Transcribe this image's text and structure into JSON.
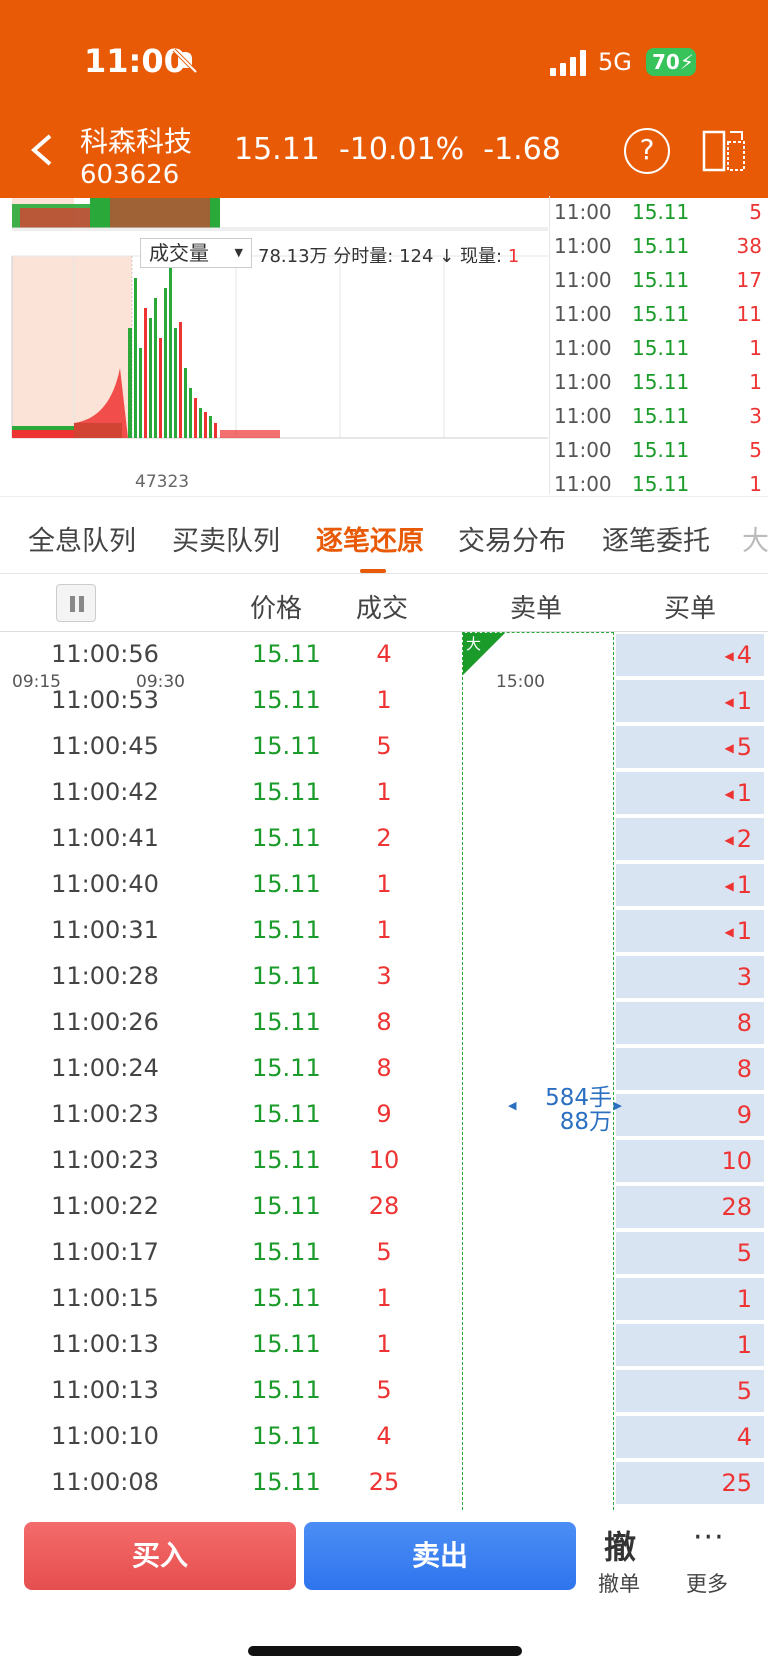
{
  "status_bar": {
    "time": "11:00",
    "network": "5G",
    "battery": "70"
  },
  "header": {
    "stock_name": "科森科技",
    "stock_code": "603626",
    "price": "15.11",
    "change_pct": "-10.01%",
    "change": "-1.68"
  },
  "chart": {
    "volume_selector": "成交量",
    "volume_total": "78.13万",
    "minute_volume_label": "分时量:",
    "minute_volume": "124",
    "current_volume_label": "现量:",
    "current_volume": "1",
    "peak_label": "47323",
    "time_start": "09:15",
    "time_mid": "09:30",
    "time_end": "15:00"
  },
  "side_ticks": [
    {
      "time": "11:00",
      "price": "15.11",
      "vol": "5"
    },
    {
      "time": "11:00",
      "price": "15.11",
      "vol": "38"
    },
    {
      "time": "11:00",
      "price": "15.11",
      "vol": "17"
    },
    {
      "time": "11:00",
      "price": "15.11",
      "vol": "11"
    },
    {
      "time": "11:00",
      "price": "15.11",
      "vol": "1"
    },
    {
      "time": "11:00",
      "price": "15.11",
      "vol": "1"
    },
    {
      "time": "11:00",
      "price": "15.11",
      "vol": "3"
    },
    {
      "time": "11:00",
      "price": "15.11",
      "vol": "5"
    },
    {
      "time": "11:00",
      "price": "15.11",
      "vol": "1"
    }
  ],
  "tabs": [
    "全息队列",
    "买卖队列",
    "逐笔还原",
    "交易分布",
    "逐笔委托",
    "大"
  ],
  "columns": {
    "price": "价格",
    "volume": "成交",
    "sell": "卖单",
    "buy": "买单"
  },
  "sell_order": {
    "big_tag": "大",
    "lots": "584手",
    "amount": "88万"
  },
  "trades": [
    {
      "time": "11:00:56",
      "price": "15.11",
      "vol": "4",
      "buy": "4",
      "arrow": true
    },
    {
      "time": "11:00:53",
      "price": "15.11",
      "vol": "1",
      "buy": "1",
      "arrow": true
    },
    {
      "time": "11:00:45",
      "price": "15.11",
      "vol": "5",
      "buy": "5",
      "arrow": true
    },
    {
      "time": "11:00:42",
      "price": "15.11",
      "vol": "1",
      "buy": "1",
      "arrow": true
    },
    {
      "time": "11:00:41",
      "price": "15.11",
      "vol": "2",
      "buy": "2",
      "arrow": true
    },
    {
      "time": "11:00:40",
      "price": "15.11",
      "vol": "1",
      "buy": "1",
      "arrow": true
    },
    {
      "time": "11:00:31",
      "price": "15.11",
      "vol": "1",
      "buy": "1",
      "arrow": true
    },
    {
      "time": "11:00:28",
      "price": "15.11",
      "vol": "3",
      "buy": "3",
      "arrow": false
    },
    {
      "time": "11:00:26",
      "price": "15.11",
      "vol": "8",
      "buy": "8",
      "arrow": false
    },
    {
      "time": "11:00:24",
      "price": "15.11",
      "vol": "8",
      "buy": "8",
      "arrow": false
    },
    {
      "time": "11:00:23",
      "price": "15.11",
      "vol": "9",
      "buy": "9",
      "arrow": false
    },
    {
      "time": "11:00:23",
      "price": "15.11",
      "vol": "10",
      "buy": "10",
      "arrow": false
    },
    {
      "time": "11:00:22",
      "price": "15.11",
      "vol": "28",
      "buy": "28",
      "arrow": false
    },
    {
      "time": "11:00:17",
      "price": "15.11",
      "vol": "5",
      "buy": "5",
      "arrow": false
    },
    {
      "time": "11:00:15",
      "price": "15.11",
      "vol": "1",
      "buy": "1",
      "arrow": false
    },
    {
      "time": "11:00:13",
      "price": "15.11",
      "vol": "1",
      "buy": "1",
      "arrow": false
    },
    {
      "time": "11:00:13",
      "price": "15.11",
      "vol": "5",
      "buy": "5",
      "arrow": false
    },
    {
      "time": "11:00:10",
      "price": "15.11",
      "vol": "4",
      "buy": "4",
      "arrow": false
    },
    {
      "time": "11:00:08",
      "price": "15.11",
      "vol": "25",
      "buy": "25",
      "arrow": false
    }
  ],
  "bottom": {
    "buy_label": "买入",
    "sell_label": "卖出",
    "cancel_icon": "撤",
    "cancel_label": "撤单",
    "more_icon": "···",
    "more_label": "更多"
  },
  "colors": {
    "header_bg": "#e85a06",
    "up_red": "#e33333",
    "down_green": "#1a9b2a",
    "buy_bg": "#d9e4f2"
  }
}
